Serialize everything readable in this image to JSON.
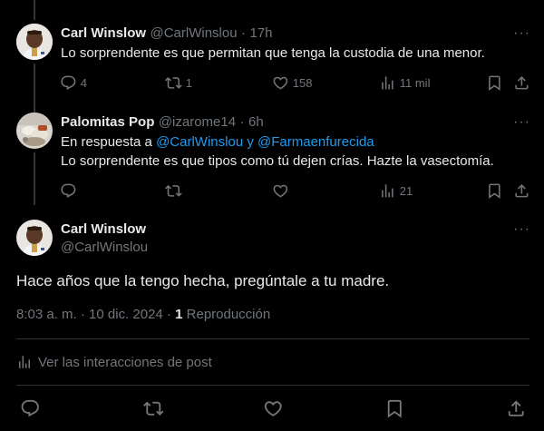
{
  "tweet1": {
    "name": "Carl Winslow",
    "handle": "@CarlWinslou",
    "separator": "·",
    "time": "17h",
    "text": "Lo sorprendente es que permitan que tenga la custodia de una menor.",
    "replies": "4",
    "retweets": "1",
    "likes": "158",
    "views": "11 mil"
  },
  "tweet2": {
    "name": "Palomitas Pop",
    "handle": "@izarome14",
    "separator": "·",
    "time": "6h",
    "reply_prefix": "En respuesta a",
    "reply_to_1": "@CarlWinslou",
    "reply_conj": "y",
    "reply_to_2": "@Farmaenfurecida",
    "text": "Lo sorprendente es que tipos como tú dejen crías. Hazte la vasectomía.",
    "replies": "",
    "retweets": "",
    "likes": "",
    "views": "21"
  },
  "main_tweet": {
    "name": "Carl Winslow",
    "handle": "@CarlWinslou",
    "text": "Hace años que la tengo hecha, pregúntale a tu madre.",
    "time": "8:03 a. m.",
    "dot": "·",
    "date": "10 dic. 2024",
    "dot2": "·",
    "plays_count": "1",
    "plays_label": "Reproducción",
    "interactions_link": "Ver las interacciones de post"
  },
  "more_label": "···",
  "icons": [
    "reply-icon",
    "retweet-icon",
    "like-icon",
    "views-icon",
    "bookmark-icon",
    "share-icon"
  ]
}
